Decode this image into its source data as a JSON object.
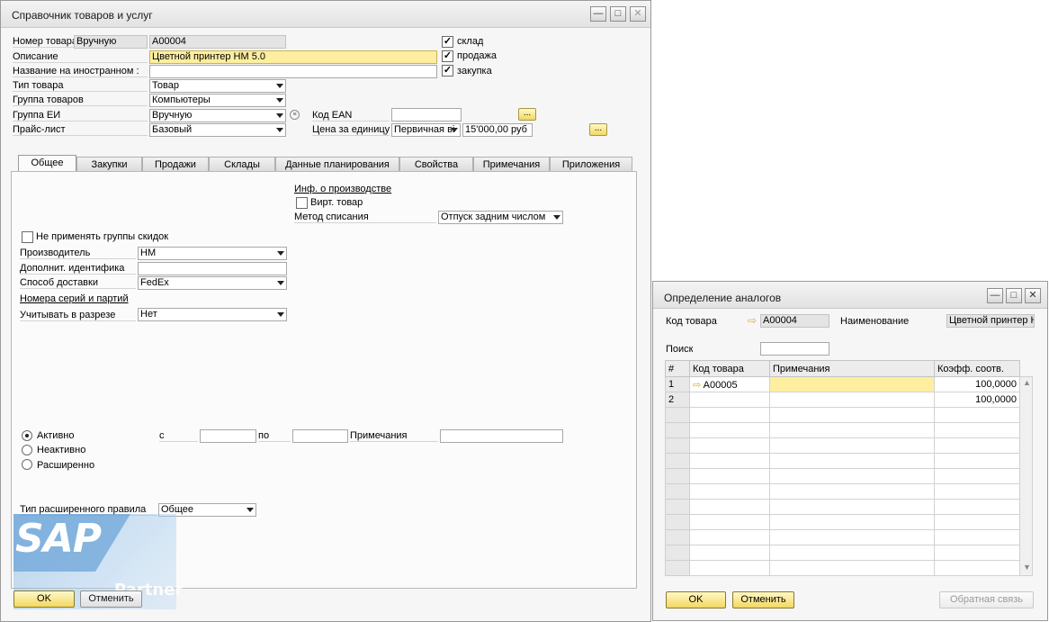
{
  "main": {
    "title": "Справочник товаров и услуг",
    "item_number_label": "Номер товара",
    "item_number_mode": "Вручную",
    "item_number": "A00004",
    "description_label": "Описание",
    "description": "Цветной принтер HM 5.0",
    "foreign_name_label": "Название на иностранном :",
    "foreign_name": "",
    "checks": [
      {
        "label": "склад",
        "checked": true
      },
      {
        "label": "продажа",
        "checked": true
      },
      {
        "label": "закупка",
        "checked": true
      }
    ],
    "item_type_label": "Тип товара",
    "item_type": "Товар",
    "item_group_label": "Группа товаров",
    "item_group": "Компьютеры",
    "uom_group_label": "Группа ЕИ",
    "uom_group": "Вручную",
    "price_list_label": "Прайс-лист",
    "price_list": "Базовый",
    "ean_label": "Код EAN",
    "ean": "",
    "unit_price_label": "Цена за единицу",
    "unit_price_unit": "Первичная ві",
    "unit_price": "15'000,00 руб",
    "dots": "...",
    "tabs": [
      "Общее",
      "Закупки",
      "Продажи",
      "Склады",
      "Данные планирования",
      "Свойства",
      "Примечания",
      "Приложения"
    ],
    "general": {
      "manufacturing_info_link": "Инф. о производстве",
      "virtual_item_label": "Вирт. товар",
      "issue_method_label": "Метод списания",
      "issue_method": "Отпуск задним числом",
      "no_discount_label": "Не применять группы скидок",
      "manufacturer_label": "Производитель",
      "manufacturer": "HM",
      "additional_id_label": "Дополнит. идентифика",
      "additional_id": "",
      "shipping_label": "Способ доставки",
      "shipping": "FedEx",
      "serial_link": "Номера серий и партий",
      "manage_by_label": "Учитывать в разрезе",
      "manage_by": "Нет",
      "status_options": [
        "Активно",
        "Неактивно",
        "Расширенно"
      ],
      "status_selected": "Активно",
      "from_label": "с",
      "to_label": "по",
      "remarks_label": "Примечания",
      "from": "",
      "to": "",
      "remarks": "",
      "adv_rule_label": "Тип расширенного правила",
      "adv_rule": "Общее"
    },
    "ok_button": "OK",
    "cancel_button": "Отменить",
    "watermark": {
      "brand": "SAP",
      "text": "Partner"
    }
  },
  "alt": {
    "title": "Определение аналогов",
    "item_code_label": "Код товара",
    "item_code": "A00004",
    "name_label": "Наименование",
    "name": "Цветной принтер Н",
    "search_label": "Поиск",
    "search": "",
    "columns": [
      "#",
      "Код товара",
      "Примечания",
      "Коэфф. соотв."
    ],
    "rows": [
      {
        "n": "1",
        "code": "A00005",
        "remarks": "",
        "factor": "100,0000"
      },
      {
        "n": "2",
        "code": "",
        "remarks": "",
        "factor": "100,0000"
      }
    ],
    "ok_button": "OK",
    "cancel_button": "Отменить",
    "feedback_button": "Обратная связь"
  }
}
